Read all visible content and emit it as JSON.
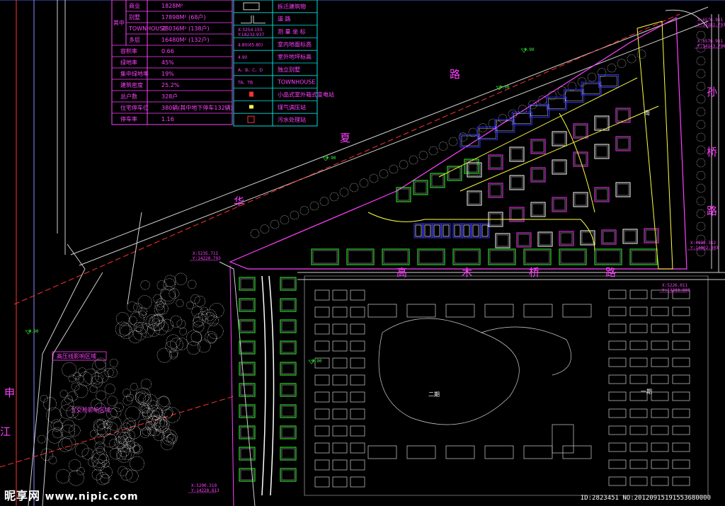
{
  "stats_table": {
    "rows": [
      {
        "label": "商业",
        "value": "1828M²"
      },
      {
        "label": "别墅",
        "value": "17898M²  (68户)"
      },
      {
        "label": "TOWNHOUSE",
        "value": "28036M²  (138户)"
      },
      {
        "label": "多层",
        "value": "16480M²  (132户)"
      },
      {
        "label": "容积率",
        "value": "0.66"
      },
      {
        "label": "绿地率",
        "value": "45%"
      },
      {
        "label": "集中绿地率",
        "value": "19%"
      },
      {
        "label": "建筑密度",
        "value": "25.2%"
      },
      {
        "label": "总户数",
        "value": "328户"
      },
      {
        "label": "住宅停车位",
        "value": "380辆(其中地下停车132辆)"
      },
      {
        "label": "停车率",
        "value": "1.16"
      }
    ],
    "group_label": "其中"
  },
  "legend": {
    "items": [
      {
        "symbol": "",
        "text": "拆迁建筑物"
      },
      {
        "symbol": "",
        "text": "道 路"
      },
      {
        "symbol": "X:3254.155\nY:18232.937",
        "text": "测 量 坐 标"
      },
      {
        "symbol": "4.80(65.80)",
        "text": "室内地面标高"
      },
      {
        "symbol": "4.90",
        "text": "室外地坪标高"
      },
      {
        "symbol": "A、B、C、D",
        "text": "独立别墅"
      },
      {
        "symbol": "TA、TB",
        "text": "TOWNHOUSE"
      },
      {
        "symbol": "",
        "text": "小品式室外箱式变电站"
      },
      {
        "symbol": "",
        "text": "煤气调压站"
      },
      {
        "symbol": "",
        "text": "污水处理站"
      }
    ]
  },
  "roads": {
    "north": [
      "华",
      "夏",
      "路"
    ],
    "east": [
      "孙",
      "桥",
      "路"
    ],
    "south": [
      "高",
      "木",
      "桥",
      "路"
    ],
    "west": [
      "申",
      "江"
    ]
  },
  "zone_labels": {
    "high_voltage": "高压线影响区域",
    "ramp": "立交桥影响区域",
    "phase2": "二期",
    "phase1": "一期",
    "north_label": "南"
  },
  "coords": [
    "X:6576.911\nY:14182.793",
    "X:6576.911\nY:14143.796",
    "X:5235.711\nY:14220.793",
    "X:5226.011\nY:14233.803",
    "X:5290.310\nY:14228.813",
    "X:4998.312\nY:14002.303"
  ],
  "elevations": [
    "4.90",
    "4.90",
    "4.90",
    "4.90",
    "4.90"
  ],
  "watermark": {
    "brand": "昵享网",
    "url": "www.nipic.com"
  },
  "image_id": "ID:2823451 NO:20120915191553680000",
  "colors": {
    "background": "#000000",
    "table_line": "#ff40ff",
    "table_cell": "#00e0e0",
    "road": "#ff40ff",
    "villa": "#ff30ff",
    "townhouse": "#3030ff",
    "multistory": "#30ff30",
    "tree": "#ffffff",
    "accent": "#ffff00"
  }
}
